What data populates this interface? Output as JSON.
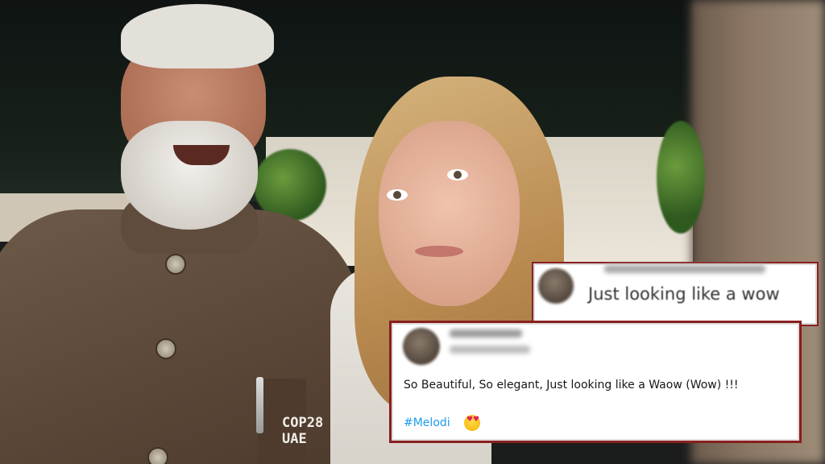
{
  "reply_back": {
    "text": "Just looking like a wow"
  },
  "reply_front": {
    "text": "So Beautiful, So elegant, Just looking like a Waow (Wow) !!!",
    "hashtag": "#Melodi",
    "emoji": "heart-eyes-emoji"
  },
  "badge": {
    "line1": "COP28",
    "line2": "UAE"
  },
  "colors": {
    "card_border": "#8a1f1f",
    "hashtag": "#1d9bf0"
  }
}
